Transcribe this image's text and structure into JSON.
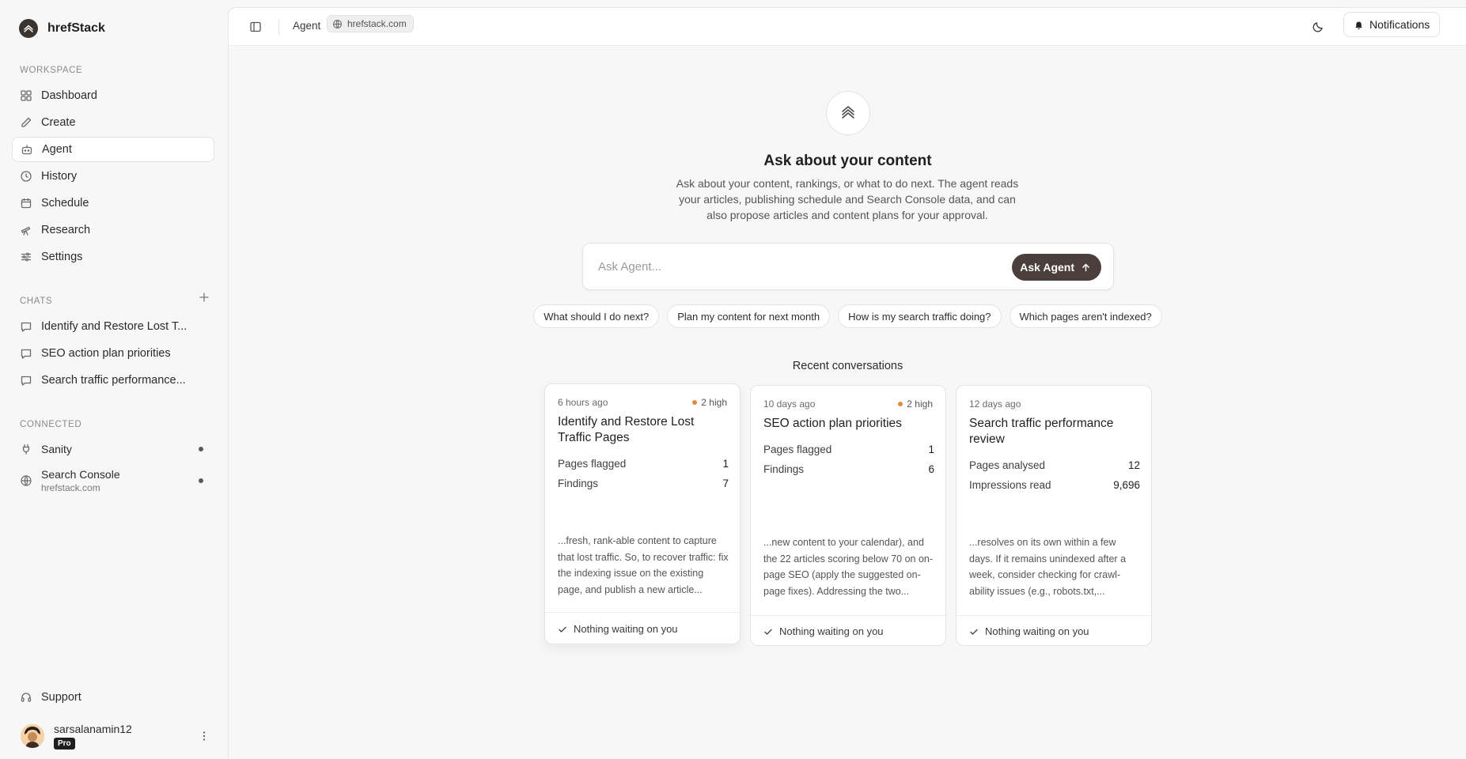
{
  "brand": {
    "name": "hrefStack"
  },
  "sidebar": {
    "workspace_label": "WORKSPACE",
    "nav": [
      {
        "label": "Dashboard",
        "icon": "dashboard-icon"
      },
      {
        "label": "Create",
        "icon": "pencil-icon"
      },
      {
        "label": "Agent",
        "icon": "robot-icon",
        "active": true
      },
      {
        "label": "History",
        "icon": "clock-icon"
      },
      {
        "label": "Schedule",
        "icon": "calendar-icon"
      },
      {
        "label": "Research",
        "icon": "telescope-icon"
      },
      {
        "label": "Settings",
        "icon": "sliders-icon"
      }
    ],
    "chats_label": "CHATS",
    "chats": [
      {
        "label": "Identify and Restore Lost T..."
      },
      {
        "label": "SEO action plan priorities"
      },
      {
        "label": "Search traffic performance..."
      }
    ],
    "connected_label": "CONNECTED",
    "connected": [
      {
        "name": "Sanity",
        "icon": "plug-icon"
      },
      {
        "name": "Search Console",
        "sub": "hrefstack.com",
        "icon": "globe-icon"
      }
    ],
    "support_label": "Support",
    "user": {
      "name": "sarsalanamin12",
      "plan": "Pro"
    }
  },
  "topbar": {
    "crumb": "Agent",
    "domain": "hrefstack.com",
    "notifications_label": "Notifications"
  },
  "hero": {
    "title": "Ask about your content",
    "description": "Ask about your content, rankings, or what to do next. The agent reads your articles, publishing schedule and Search Console data, and can also propose articles and content plans for your approval.",
    "input_placeholder": "Ask Agent...",
    "ask_button": "Ask Agent"
  },
  "suggestions": [
    "What should I do next?",
    "Plan my content for next month",
    "How is my search traffic doing?",
    "Which pages aren't indexed?"
  ],
  "recent": {
    "label": "Recent conversations",
    "cards": [
      {
        "time": "6 hours ago",
        "badge": "2 high",
        "title": "Identify and Restore Lost Traffic Pages",
        "stats": [
          {
            "label": "Pages flagged",
            "value": "1"
          },
          {
            "label": "Findings",
            "value": "7"
          }
        ],
        "excerpt": "...fresh, rank-able content to capture that lost traffic. So, to recover traffic: fix the indexing issue on the existing page, and publish a new article...",
        "footer": "Nothing waiting on you"
      },
      {
        "time": "10 days ago",
        "badge": "2 high",
        "title": "SEO action plan priorities",
        "stats": [
          {
            "label": "Pages flagged",
            "value": "1"
          },
          {
            "label": "Findings",
            "value": "6"
          }
        ],
        "excerpt": "...new content to your calendar), and the 22 articles scoring below 70 on on-page SEO (apply the suggested on-page fixes). Addressing the two...",
        "footer": "Nothing waiting on you"
      },
      {
        "time": "12 days ago",
        "badge": "",
        "title": "Search traffic performance review",
        "stats": [
          {
            "label": "Pages analysed",
            "value": "12"
          },
          {
            "label": "Impressions read",
            "value": "9,696"
          }
        ],
        "excerpt": "...resolves on its own within a few days. If it remains unindexed after a week, consider checking for crawl-ability issues (e.g., robots.txt,...",
        "footer": "Nothing waiting on you"
      }
    ]
  },
  "colors": {
    "accent": "#4a3f3a",
    "high_dot": "#e08a3c"
  }
}
